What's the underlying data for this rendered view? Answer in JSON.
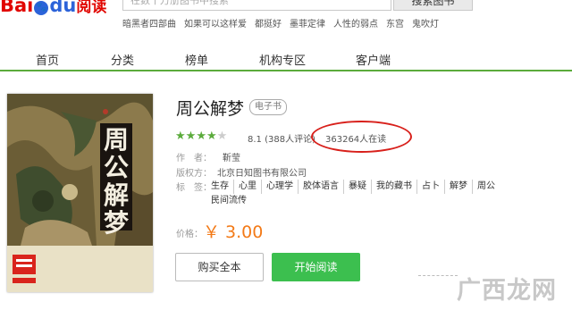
{
  "header": {
    "logo": {
      "bai": "Bai",
      "paw": "🐾",
      "du": "du",
      "yuedu": "阅读"
    },
    "search_placeholder": "在数十万册图书中搜索",
    "search_button": "搜索图书",
    "hot_words": [
      "暗黑者四部曲",
      "如果可以这样爱",
      "都挺好",
      "墨菲定律",
      "人性的弱点",
      "东宫",
      "鬼吹灯"
    ]
  },
  "nav": {
    "items": [
      "首页",
      "分类",
      "榜单",
      "机构专区",
      "客户端"
    ]
  },
  "book": {
    "cover_title": "周公解梦",
    "title": "周公解梦",
    "badge": "电子书",
    "stars": {
      "filled": 4,
      "total": 5
    },
    "rating": "8.1 (388人评论)",
    "readers": "363264人在读",
    "author_label": "作　者：",
    "author": "靳莹",
    "publisher_label": "版权方：",
    "publisher": "北京日知图书有限公司",
    "tags_label": "标　签：",
    "tags": [
      "生存",
      "心里",
      "心理学",
      "胶体语言",
      "暴疑",
      "我的藏书",
      "占卜",
      "解梦",
      "周公",
      "民间流传"
    ],
    "price_label": "价格：",
    "price": "￥ 3.00",
    "buy_button": "购买全本",
    "read_button": "开始阅读"
  },
  "watermark": "广西龙网",
  "colors": {
    "brand_red": "#e10601",
    "brand_blue": "#2c63d9",
    "nav_green": "#5bab3c",
    "button_green": "#3cbf4f",
    "price_orange": "#f37a17",
    "annotation_red": "#d8201b"
  }
}
